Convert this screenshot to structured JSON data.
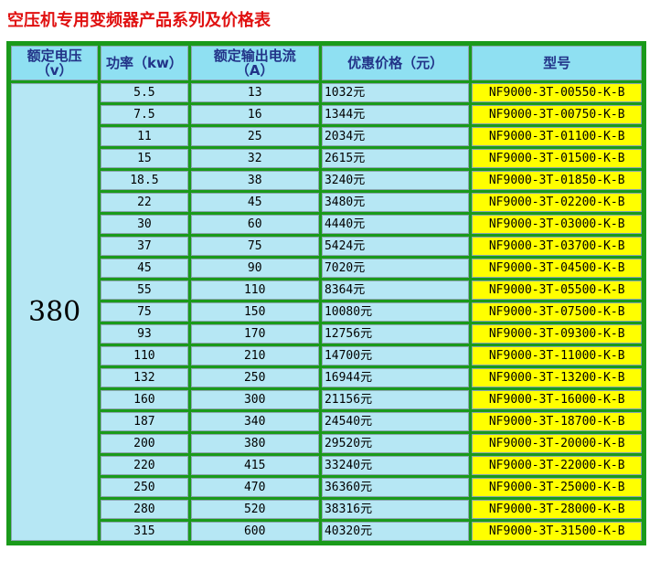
{
  "title": "空压机专用变频器产品系列及价格表",
  "headers": {
    "voltage_l1": "额定电压",
    "voltage_l2": "（v）",
    "power": "功率（kw）",
    "current_l1": "额定输出电流",
    "current_l2": "（A）",
    "price": "优惠价格（元）",
    "model": "型号"
  },
  "voltage": "380",
  "rows": [
    {
      "power": "5.5",
      "current": "13",
      "price": "1032元",
      "model": "NF9000-3T-00550-K-B"
    },
    {
      "power": "7.5",
      "current": "16",
      "price": "1344元",
      "model": "NF9000-3T-00750-K-B"
    },
    {
      "power": "11",
      "current": "25",
      "price": "2034元",
      "model": "NF9000-3T-01100-K-B"
    },
    {
      "power": "15",
      "current": "32",
      "price": "2615元",
      "model": "NF9000-3T-01500-K-B"
    },
    {
      "power": "18.5",
      "current": "38",
      "price": "3240元",
      "model": "NF9000-3T-01850-K-B"
    },
    {
      "power": "22",
      "current": "45",
      "price": "3480元",
      "model": "NF9000-3T-02200-K-B"
    },
    {
      "power": "30",
      "current": "60",
      "price": "4440元",
      "model": "NF9000-3T-03000-K-B"
    },
    {
      "power": "37",
      "current": "75",
      "price": "5424元",
      "model": "NF9000-3T-03700-K-B"
    },
    {
      "power": "45",
      "current": "90",
      "price": "7020元",
      "model": "NF9000-3T-04500-K-B"
    },
    {
      "power": "55",
      "current": "110",
      "price": "8364元",
      "model": "NF9000-3T-05500-K-B"
    },
    {
      "power": "75",
      "current": "150",
      "price": "10080元",
      "model": "NF9000-3T-07500-K-B"
    },
    {
      "power": "93",
      "current": "170",
      "price": "12756元",
      "model": "NF9000-3T-09300-K-B"
    },
    {
      "power": "110",
      "current": "210",
      "price": "14700元",
      "model": "NF9000-3T-11000-K-B"
    },
    {
      "power": "132",
      "current": "250",
      "price": "16944元",
      "model": "NF9000-3T-13200-K-B"
    },
    {
      "power": "160",
      "current": "300",
      "price": "21156元",
      "model": "NF9000-3T-16000-K-B"
    },
    {
      "power": "187",
      "current": "340",
      "price": "24540元",
      "model": "NF9000-3T-18700-K-B"
    },
    {
      "power": "200",
      "current": "380",
      "price": "29520元",
      "model": "NF9000-3T-20000-K-B"
    },
    {
      "power": "220",
      "current": "415",
      "price": "33240元",
      "model": "NF9000-3T-22000-K-B"
    },
    {
      "power": "250",
      "current": "470",
      "price": "36360元",
      "model": "NF9000-3T-25000-K-B"
    },
    {
      "power": "280",
      "current": "520",
      "price": "38316元",
      "model": "NF9000-3T-28000-K-B"
    },
    {
      "power": "315",
      "current": "600",
      "price": "40320元",
      "model": "NF9000-3T-31500-K-B"
    }
  ],
  "colors": {
    "title": "#e01010",
    "border_green": "#1a9a1a",
    "header_bg": "#8fe0f2",
    "header_text": "#223388",
    "cell_bg": "#b6e7f4",
    "model_bg": "#ffff00"
  }
}
